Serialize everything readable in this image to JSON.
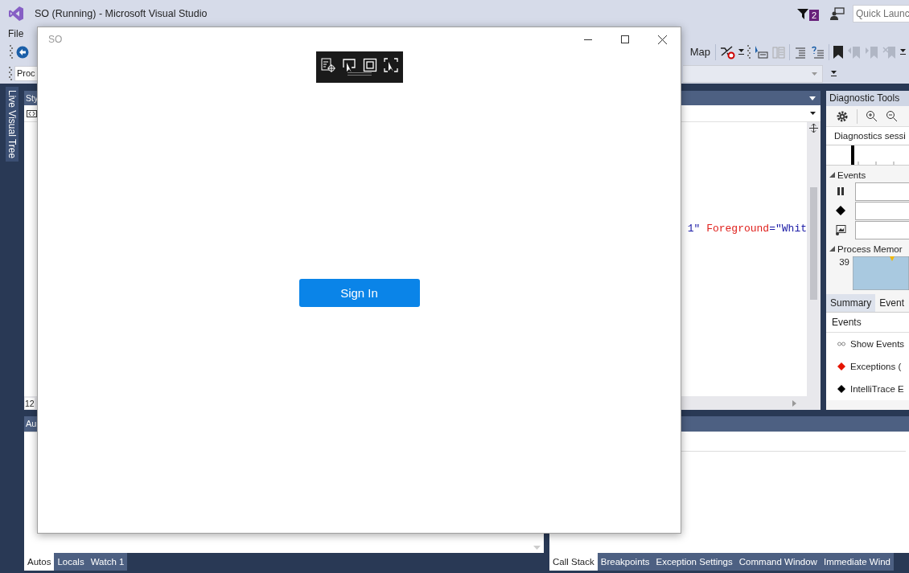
{
  "window": {
    "title": "SO (Running) - Microsoft Visual Studio"
  },
  "notifications": {
    "count": "2"
  },
  "quick_launch": {
    "placeholder": "Quick Launc"
  },
  "menu": [
    "File"
  ],
  "toolbar": {
    "label": "Map"
  },
  "process_combo": {
    "value": "Proc"
  },
  "side_tabs": [
    "Live Visual Tree"
  ],
  "editor": {
    "tab_label": "Sty",
    "zoom": "12",
    "code_line": [
      {
        "kind": "value",
        "text": "1\""
      },
      {
        "kind": "attr",
        "text": " Foreground"
      },
      {
        "kind": "value",
        "text": "=\"Whit"
      }
    ]
  },
  "diagnostic_tools": {
    "title": "Diagnostic Tools",
    "session_label": "Diagnostics sessi",
    "events_header": "Events",
    "memory_header": "Process Memor",
    "memory_value": "39",
    "tabs": [
      {
        "label": "Summary",
        "selected": true
      },
      {
        "label": "Event",
        "selected": false
      }
    ],
    "events_title": "Events",
    "event_items": [
      {
        "kind": "link",
        "label": "Show Events"
      },
      {
        "kind": "exception",
        "label": "Exceptions ("
      },
      {
        "kind": "intellitrace",
        "label": "IntelliTrace E"
      }
    ]
  },
  "autos_pane": {
    "title": "Au",
    "tabs": [
      {
        "label": "Autos",
        "selected": true
      },
      {
        "label": "Locals",
        "selected": false
      },
      {
        "label": "Watch 1",
        "selected": false
      }
    ]
  },
  "callstack_pane": {
    "tabs": [
      {
        "label": "Call Stack",
        "selected": true
      },
      {
        "label": "Breakpoints",
        "selected": false
      },
      {
        "label": "Exception Settings",
        "selected": false
      },
      {
        "label": "Command Window",
        "selected": false
      },
      {
        "label": "Immediate Wind",
        "selected": false
      }
    ]
  },
  "app_window": {
    "title": "SO",
    "button_label": "Sign In"
  }
}
